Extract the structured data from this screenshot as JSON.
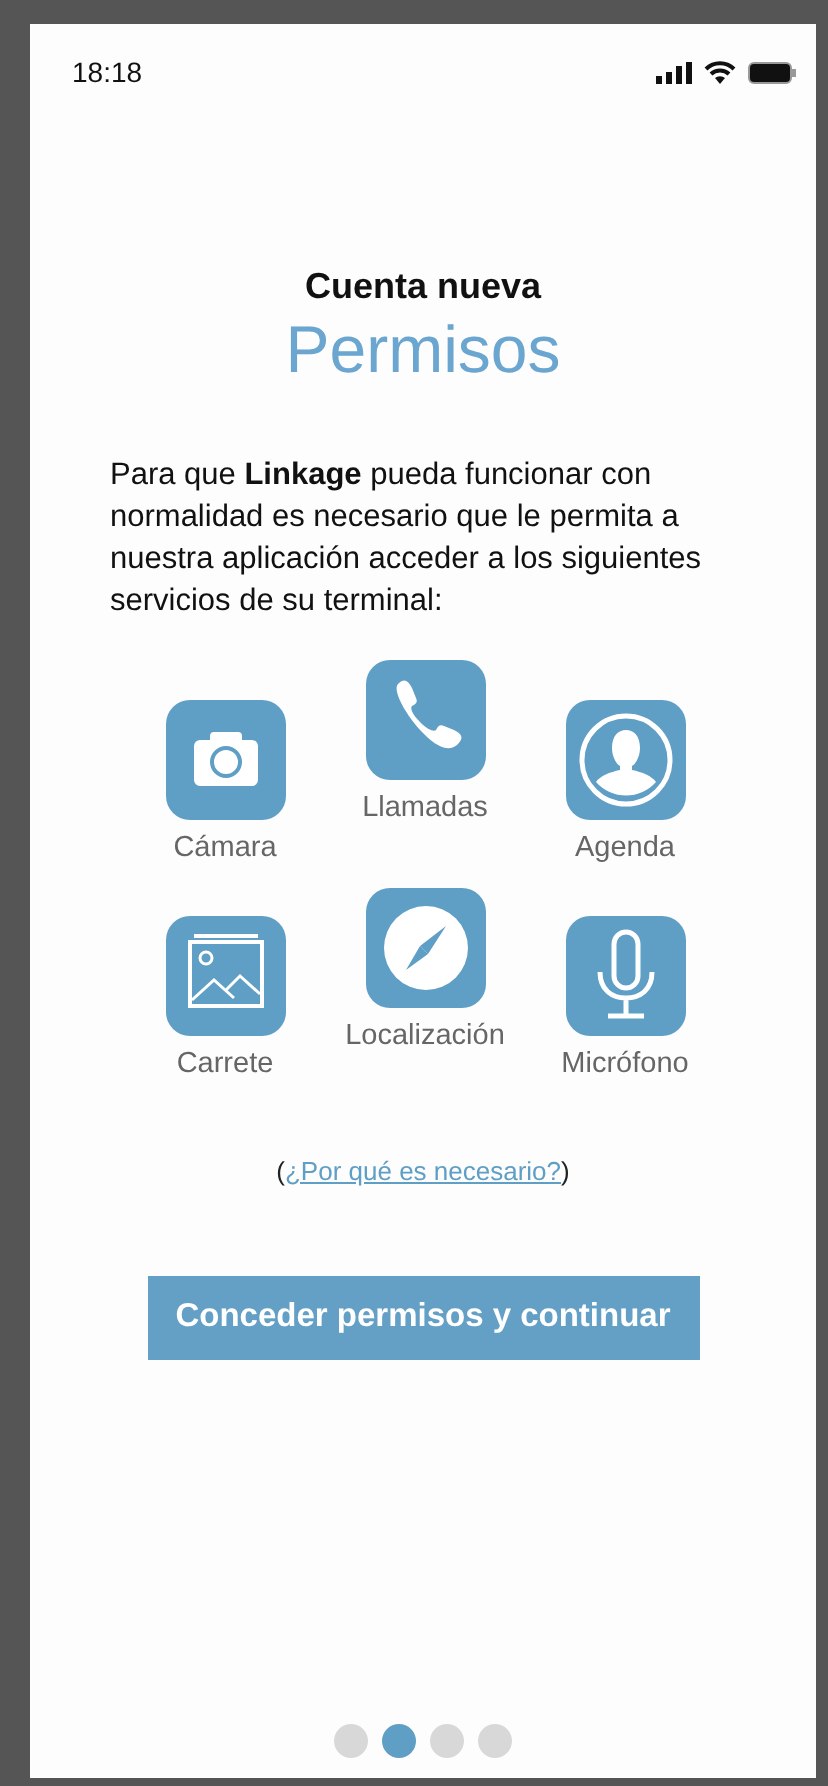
{
  "status_bar": {
    "time": "18:18"
  },
  "header": {
    "subtitle": "Cuenta nueva",
    "title": "Permisos"
  },
  "intro": "Para que **Linkage** pueda funcionar con normalidad es necesario que le permita a nuestra aplicación acceder a los siguientes servicios de su terminal:",
  "permission_columns": [
    [
      {
        "kind": "camera",
        "label": "Cámara"
      },
      {
        "kind": "gallery",
        "label": "Carrete"
      }
    ],
    [
      {
        "kind": "phone",
        "label": "Llamadas"
      },
      {
        "kind": "compass",
        "label": "Localización"
      }
    ],
    [
      {
        "kind": "contact",
        "label": "Agenda"
      },
      {
        "kind": "microphone",
        "label": "Micrófono"
      }
    ]
  ],
  "why": {
    "open": "(",
    "link": "¿Por qué es necesario?",
    "close": ")"
  },
  "button": "Conceder permisos y continuar",
  "pager": [
    {
      "selected": false
    },
    {
      "selected": true
    },
    {
      "selected": false
    },
    {
      "selected": false
    }
  ]
}
